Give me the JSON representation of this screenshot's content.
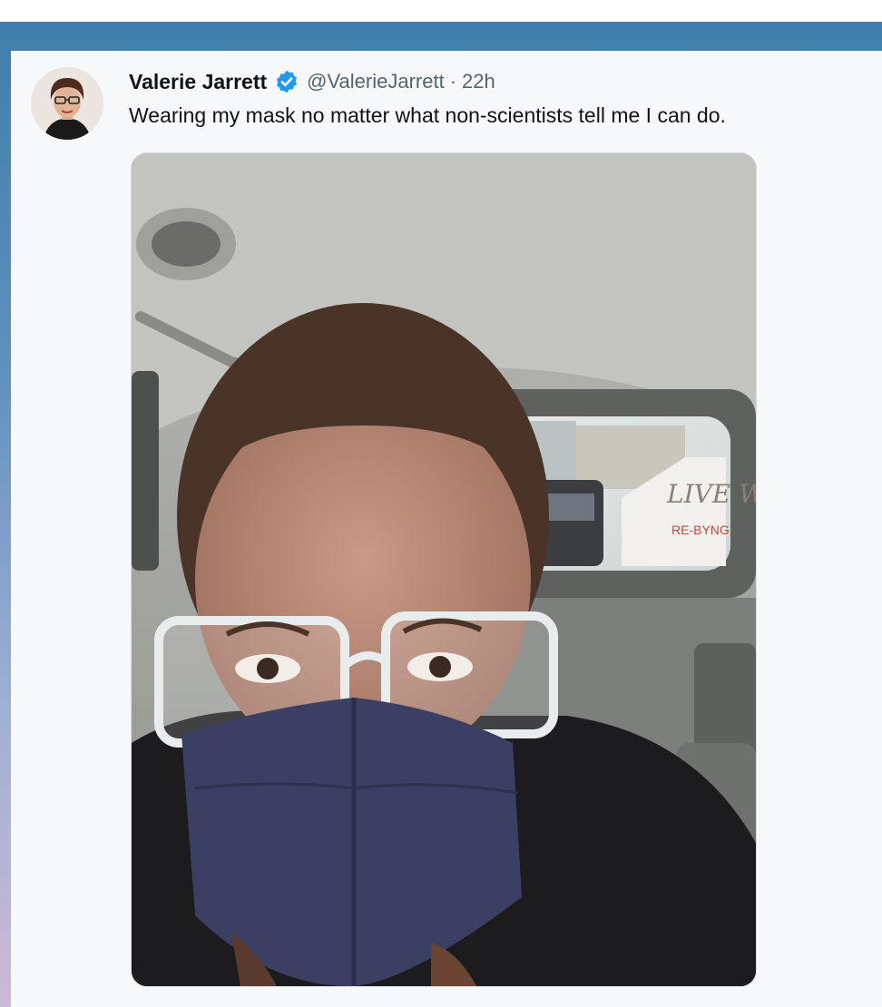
{
  "tweet": {
    "display_name": "Valerie Jarrett",
    "handle": "@ValerieJarrett",
    "separator": "·",
    "time_ago": "22h",
    "text": "Wearing my mask no matter what non-scientists tell me I can do.",
    "verified_badge_color": "#1d9bf0"
  },
  "media": {
    "truck_lettering_1": "LIVE W",
    "truck_lettering_2": "RE-BYNG"
  },
  "colors": {
    "top_bar": "#3f7eac",
    "card_background": "#f7f8f9",
    "name_text": "#0f1419",
    "meta_text": "#536471"
  },
  "icons": [
    "verified-badge-icon"
  ]
}
